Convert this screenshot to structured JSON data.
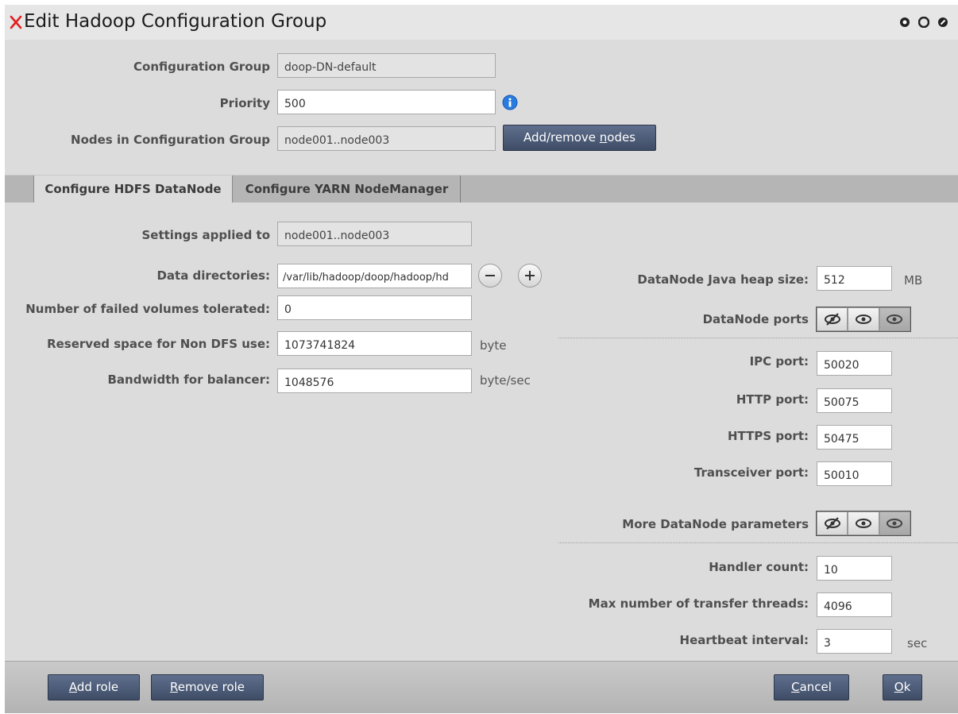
{
  "window": {
    "title": "Edit Hadoop Configuration Group"
  },
  "header": {
    "config_group_label": "Configuration Group",
    "config_group_value": "doop-DN-default",
    "priority_label": "Priority",
    "priority_value": "500",
    "nodes_label": "Nodes in Configuration Group",
    "nodes_value": "node001..node003",
    "add_remove_pre": "Add/remove ",
    "add_remove_ul": "n",
    "add_remove_post": "odes"
  },
  "tabs": [
    {
      "label": "Configure HDFS DataNode",
      "active": true
    },
    {
      "label": "Configure YARN NodeManager",
      "active": false
    }
  ],
  "left": {
    "settings_label": "Settings applied to",
    "settings_value": "node001..node003",
    "data_dirs_label": "Data directories:",
    "data_dirs_value": "/var/lib/hadoop/doop/hadoop/hd",
    "failed_volumes_label": "Number of failed volumes tolerated:",
    "failed_volumes_value": "0",
    "reserved_label": "Reserved space for Non DFS use:",
    "reserved_value": "1073741824",
    "reserved_unit": "byte",
    "bandwidth_label": "Bandwidth for balancer:",
    "bandwidth_value": "1048576",
    "bandwidth_unit": "byte/sec"
  },
  "right": {
    "heap_label": "DataNode Java heap size:",
    "heap_value": "512",
    "heap_unit": "MB",
    "ports_label": "DataNode ports",
    "ipc_label": "IPC port:",
    "ipc_value": "50020",
    "http_label": "HTTP port:",
    "http_value": "50075",
    "https_label": "HTTPS port:",
    "https_value": "50475",
    "transceiver_label": "Transceiver port:",
    "transceiver_value": "50010",
    "more_label": "More DataNode parameters",
    "handler_label": "Handler count:",
    "handler_value": "10",
    "threads_label": "Max number of transfer threads:",
    "threads_value": "4096",
    "heartbeat_label": "Heartbeat interval:",
    "heartbeat_value": "3",
    "heartbeat_unit": "sec"
  },
  "footer": {
    "add_role_ul": "A",
    "add_role_rest": "dd role",
    "remove_role_ul": "R",
    "remove_role_rest": "emove role",
    "cancel_ul": "C",
    "cancel_rest": "ancel",
    "ok_ul": "O",
    "ok_rest": "k"
  },
  "icons": {
    "close": "close-x-icon",
    "info": "info-icon",
    "minus": "minus-icon",
    "plus": "plus-icon",
    "hidden": "eye-slash-icon",
    "visible": "eye-icon"
  },
  "colors": {
    "accent_button": "#4a5874",
    "close_x": "#e02020",
    "info_blue": "#2a7be0"
  }
}
